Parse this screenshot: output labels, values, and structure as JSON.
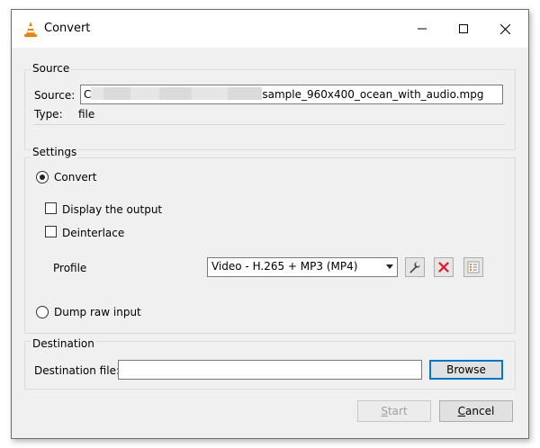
{
  "window": {
    "title": "Convert",
    "icon": "vlc-cone-icon"
  },
  "source": {
    "group_label": "Source",
    "source_label": "Source:",
    "path_start": "C",
    "path_end": "sample_960x400_ocean_with_audio.mpg",
    "type_label": "Type:",
    "type_value": "file"
  },
  "settings": {
    "group_label": "Settings",
    "convert_label": "Convert",
    "display_output_label": "Display the output",
    "deinterlace_label": "Deinterlace",
    "profile_label": "Profile",
    "profile_value": "Video - H.265 + MP3 (MP4)",
    "dump_raw_label": "Dump raw input"
  },
  "destination": {
    "group_label": "Destination",
    "file_label": "Destination file:",
    "file_value": "",
    "browse_label": "Browse"
  },
  "footer": {
    "start_first": "S",
    "start_rest": "tart",
    "cancel_first": "C",
    "cancel_rest": "ancel"
  },
  "state": {
    "convert_selected": true,
    "display_output_checked": false,
    "deinterlace_checked": false,
    "start_enabled": false
  },
  "colors": {
    "accent": "#0078d7",
    "delete_icon": "#e81123",
    "vlc_orange": "#f08000"
  }
}
